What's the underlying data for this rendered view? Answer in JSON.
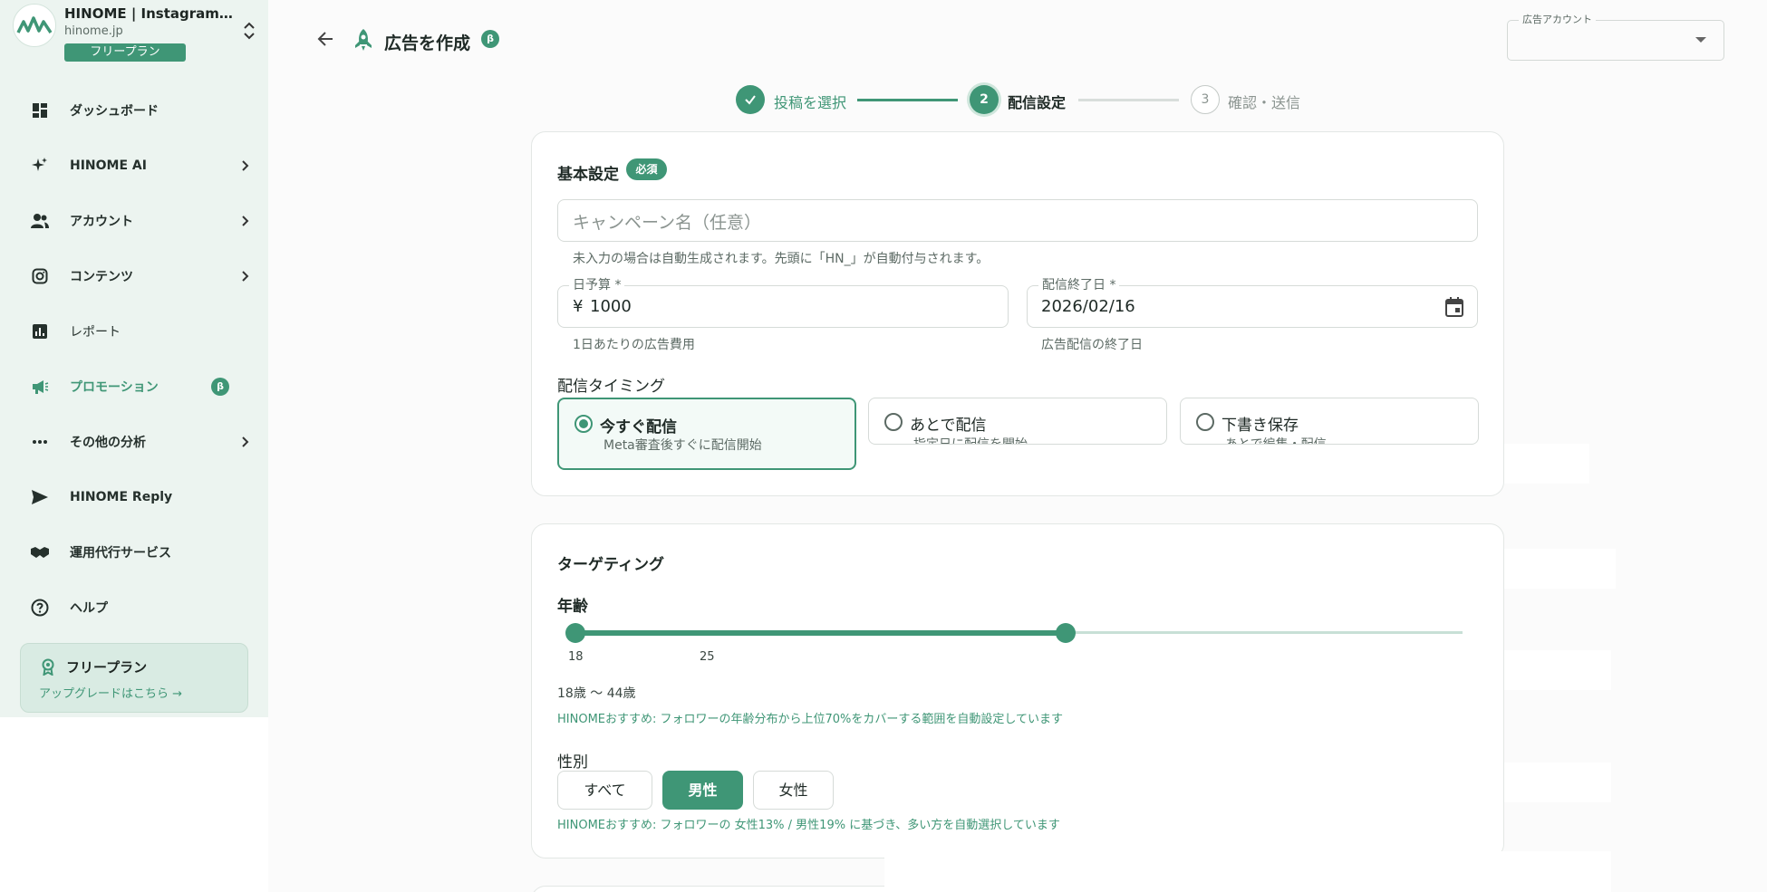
{
  "sidebar": {
    "brand": {
      "name": "HINOME | Instagram分析...",
      "domain": "hinome.jp",
      "plan": "フリープラン"
    },
    "items": [
      {
        "label": "ダッシュボード",
        "icon": "dashboard-icon"
      },
      {
        "label": "HINOME AI",
        "icon": "sparkle-icon"
      },
      {
        "label": "アカウント",
        "icon": "people-icon"
      },
      {
        "label": "コンテンツ",
        "icon": "instagram-icon"
      },
      {
        "label": "レポート",
        "icon": "chart-icon"
      },
      {
        "label": "プロモーション",
        "icon": "megaphone-icon",
        "badge": "β"
      },
      {
        "label": "その他の分析",
        "icon": "more-icon"
      },
      {
        "label": "HINOME Reply",
        "icon": "send-icon"
      },
      {
        "label": "運用代行サービス",
        "icon": "handshake-icon"
      },
      {
        "label": "ヘルプ",
        "icon": "help-icon"
      }
    ],
    "upgrade": {
      "title": "フリープラン",
      "link": "アップグレードはこちら →"
    }
  },
  "header": {
    "title": "広告を作成",
    "badge": "β",
    "account_label": "広告アカウント",
    "account_value": ""
  },
  "stepper": {
    "steps": [
      {
        "number": "✓",
        "label": "投稿を選択",
        "state": "done"
      },
      {
        "number": "2",
        "label": "配信設定",
        "state": "active"
      },
      {
        "number": "3",
        "label": "確認・送信",
        "state": "pending"
      }
    ]
  },
  "basic": {
    "title": "基本設定",
    "required": "必須",
    "campaign_placeholder": "キャンペーン名（任意）",
    "campaign_helper": "未入力の場合は自動生成されます。先頭に「HN_」が自動付与されます。",
    "budget_label": "日予算 *",
    "budget_prefix": "¥",
    "budget_value": "1000",
    "budget_helper": "1日あたりの広告費用",
    "end_label": "配信終了日 *",
    "end_value": "2026/02/16",
    "end_helper": "広告配信の終了日",
    "timing_title": "配信タイミング",
    "timing_options": [
      {
        "title": "今すぐ配信",
        "desc": "Meta審査後すぐに配信開始",
        "selected": true
      },
      {
        "title": "あとで配信",
        "desc": "指定日に配信を開始",
        "selected": false
      },
      {
        "title": "下書き保存",
        "desc": "あとで編集・配信",
        "selected": false
      }
    ]
  },
  "targeting": {
    "title": "ターゲティング",
    "age_title": "年齢",
    "age_ticks": [
      "18",
      "25"
    ],
    "age_range_text": "18歳 〜 44歳",
    "age_recommend": "HINOMEおすすめ: フォロワーの年齢分布から上位70%をカバーする範囲を自動設定しています",
    "gender_title": "性別",
    "gender_options": [
      {
        "label": "すべて",
        "selected": false
      },
      {
        "label": "男性",
        "selected": true
      },
      {
        "label": "女性",
        "selected": false
      }
    ],
    "gender_recommend": "HINOMEおすすめ: フォロワーの 女性13% / 男性19% に基づき、多い方を自動選択しています"
  },
  "colors": {
    "accent": "#3f9676",
    "sidebar_bg": "#ecf4f0"
  }
}
